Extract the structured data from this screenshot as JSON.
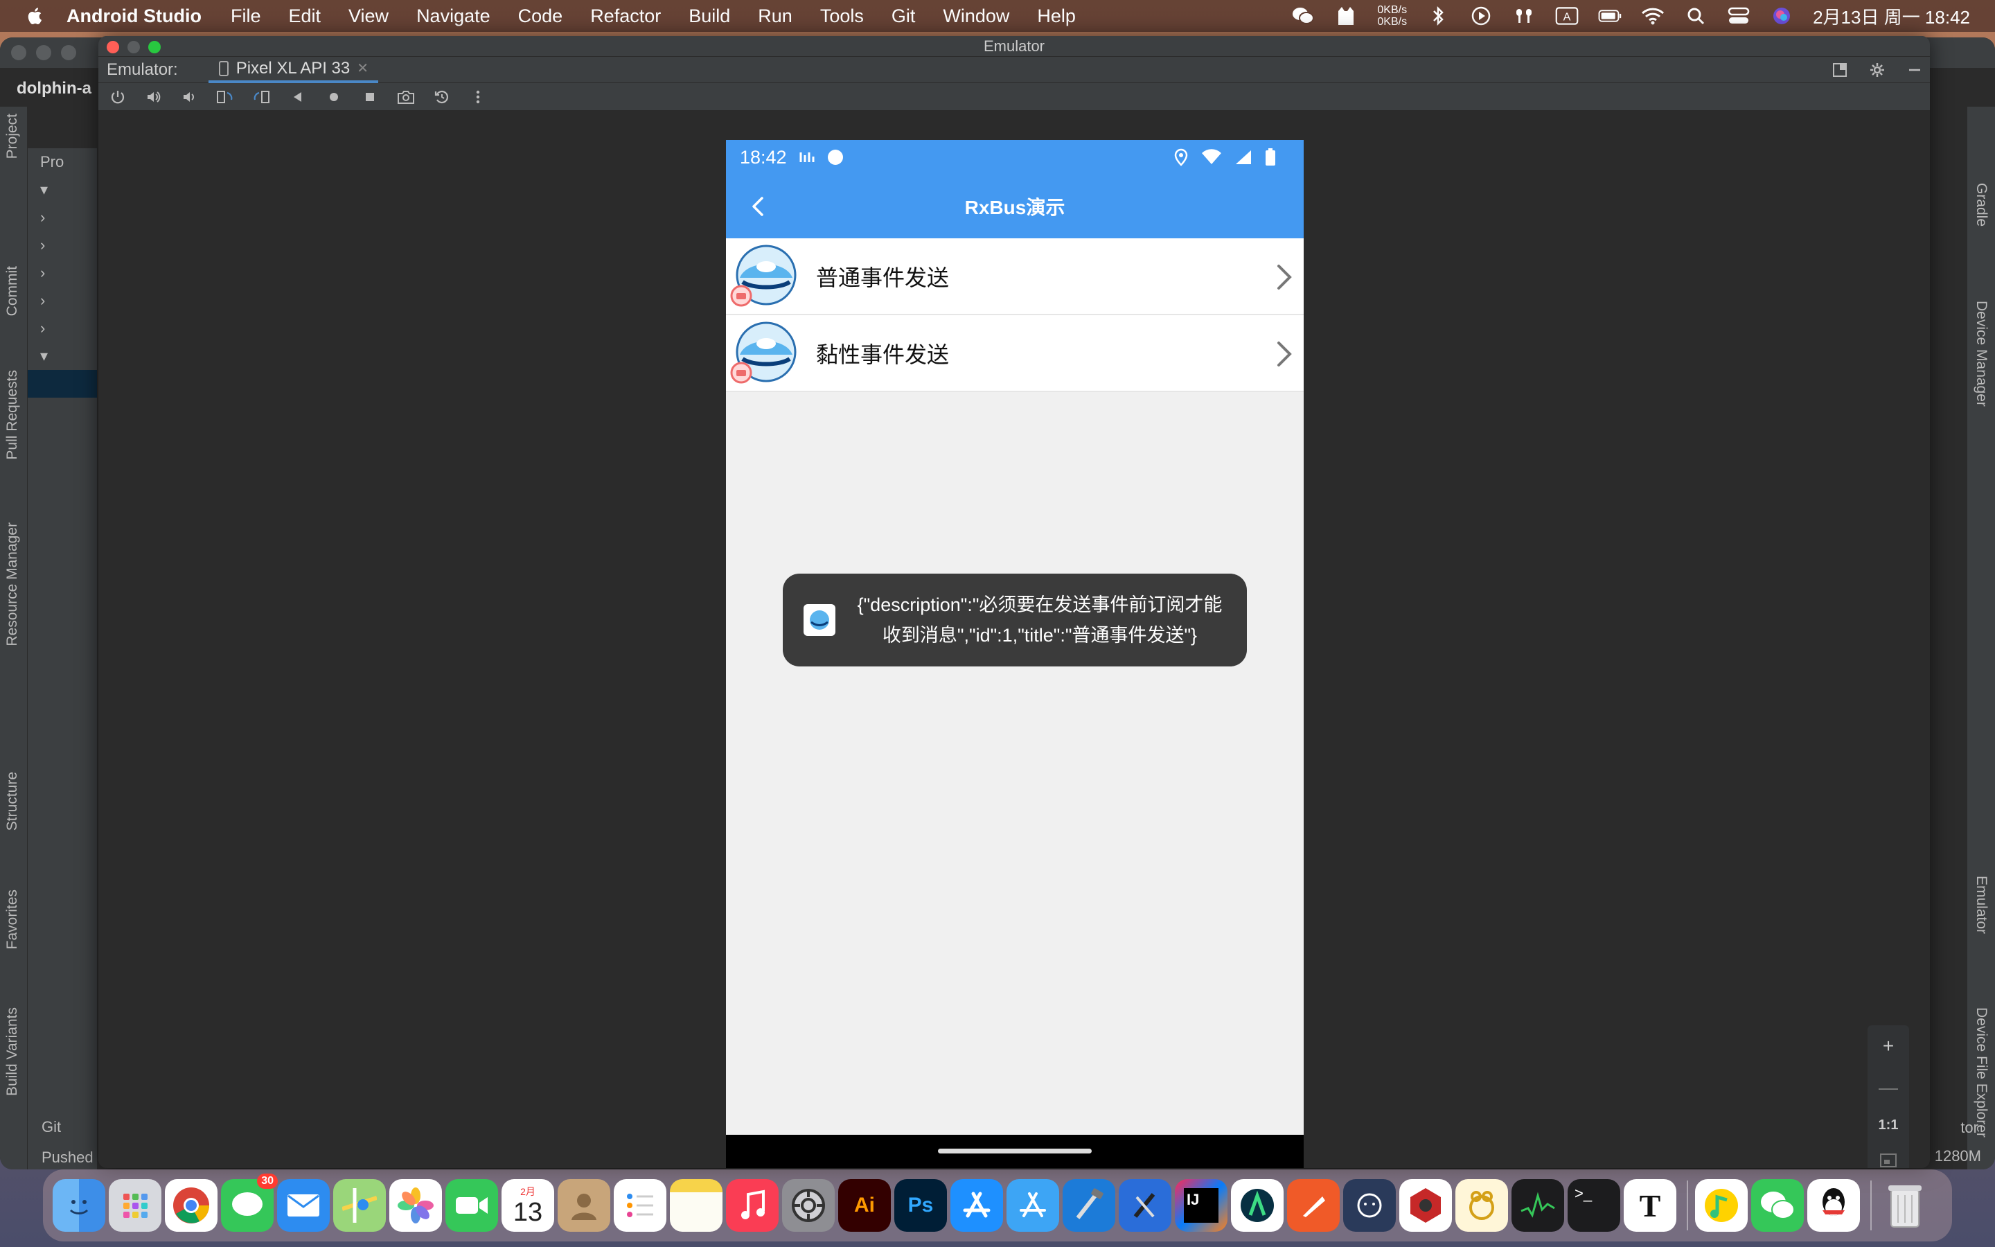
{
  "menubar": {
    "app_name": "Android Studio",
    "items": [
      "File",
      "Edit",
      "View",
      "Navigate",
      "Code",
      "Refactor",
      "Build",
      "Run",
      "Tools",
      "Git",
      "Window",
      "Help"
    ],
    "net_up": "0KB/s",
    "net_down": "0KB/s",
    "input_method": "A",
    "clock": "2月13日 周一  18:42"
  },
  "ide": {
    "project_name": "dolphin-a",
    "panel_title": "Pro",
    "left_tools": [
      "Project",
      "Commit",
      "Pull Requests",
      "Resource Manager",
      "Structure",
      "Favorites",
      "Build Variants"
    ],
    "right_tools": [
      "Gradle",
      "Device Manager",
      "Emulator",
      "Device File Explorer"
    ],
    "git_label": "Git",
    "status_text": "Pushed",
    "memory": "1280M",
    "right_tool_fragment": "tor"
  },
  "emulator": {
    "window_title": "Emulator",
    "panel_label": "Emulator:",
    "device_tab": "Pixel XL API 33",
    "zoom_one_to_one": "1:1"
  },
  "phone": {
    "time": "18:42",
    "toolbar_title": "RxBus演示",
    "rows": [
      {
        "label": "普通事件发送"
      },
      {
        "label": "黏性事件发送"
      }
    ],
    "toast": "{\"description\":\"必须要在发送事件前订阅才能收到消息\",\"id\":1,\"title\":\"普通事件发送\"}"
  },
  "dock": {
    "messages_badge": "30",
    "calendar_month": "2月",
    "calendar_day": "13",
    "apps": [
      "Finder",
      "Launchpad",
      "Chrome",
      "Messages",
      "Mail",
      "Maps",
      "Photos",
      "FaceTime",
      "Calendar",
      "Contacts",
      "Reminders",
      "Notes",
      "Music",
      "System Preferences",
      "Illustrator",
      "Photoshop",
      "App Store",
      "App Store Connect",
      "Xcode",
      "Instruments",
      "IntelliJ IDEA",
      "Android Studio",
      "Bird",
      "ChatGPT",
      "Hex",
      "Lark",
      "Activity Monitor",
      "Terminal",
      "Typora",
      "QQ Music",
      "WeChat",
      "QQ",
      "Trash"
    ]
  },
  "colors": {
    "primary": "#4499f1",
    "toast_bg": "#3b3b3b",
    "ide_bg": "#2b2b2b",
    "tab_accent": "#4a88c7"
  }
}
